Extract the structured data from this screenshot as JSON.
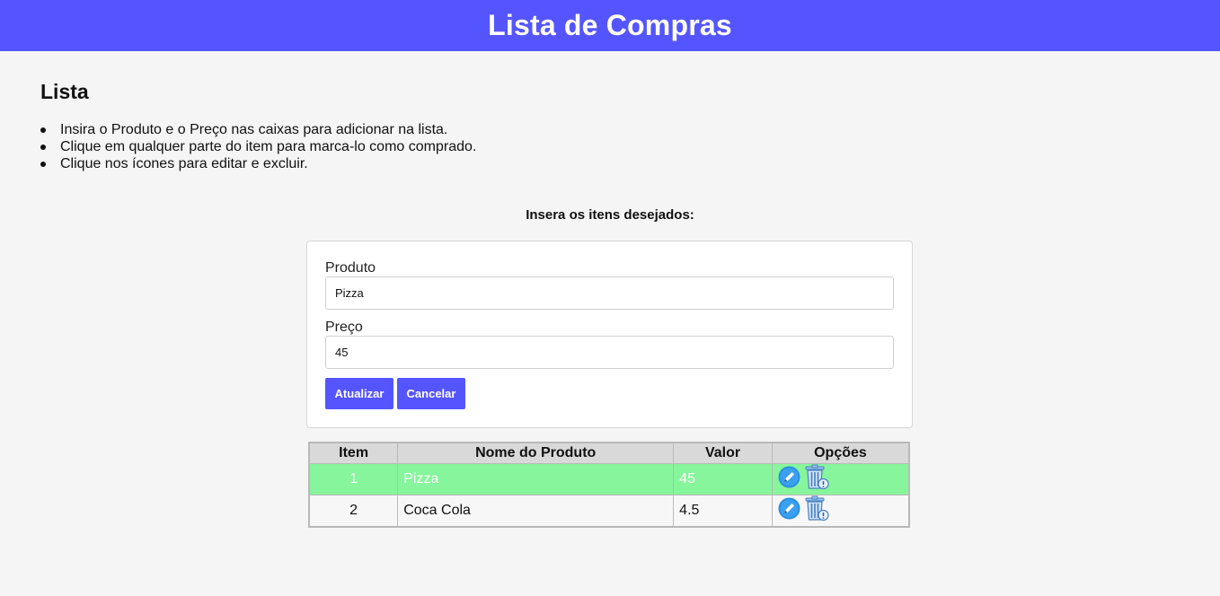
{
  "header": {
    "title": "Lista de Compras"
  },
  "section": {
    "title": "Lista"
  },
  "instructions": [
    "Insira o Produto e o Preço nas caixas para adicionar na lista.",
    "Clique em qualquer parte do item para marca-lo como comprado.",
    "Clique nos ícones para editar e excluir."
  ],
  "form": {
    "heading": "Insera os itens desejados:",
    "product_label": "Produto",
    "product_value": "Pizza",
    "price_label": "Preço",
    "price_value": "45",
    "update_button": "Atualizar",
    "cancel_button": "Cancelar"
  },
  "table": {
    "headers": [
      "Item",
      "Nome do Produto",
      "Valor",
      "Opções"
    ],
    "rows": [
      {
        "item": "1",
        "name": "Pizza",
        "value": "45",
        "bought": true
      },
      {
        "item": "2",
        "name": "Coca Cola",
        "value": "4.5",
        "bought": false
      }
    ]
  },
  "icons": {
    "edit": "pencil-icon",
    "delete": "trash-icon"
  },
  "colors": {
    "accent": "#5555ff",
    "bought_row": "#86f59b",
    "edit_icon": "#2a8ee0"
  }
}
